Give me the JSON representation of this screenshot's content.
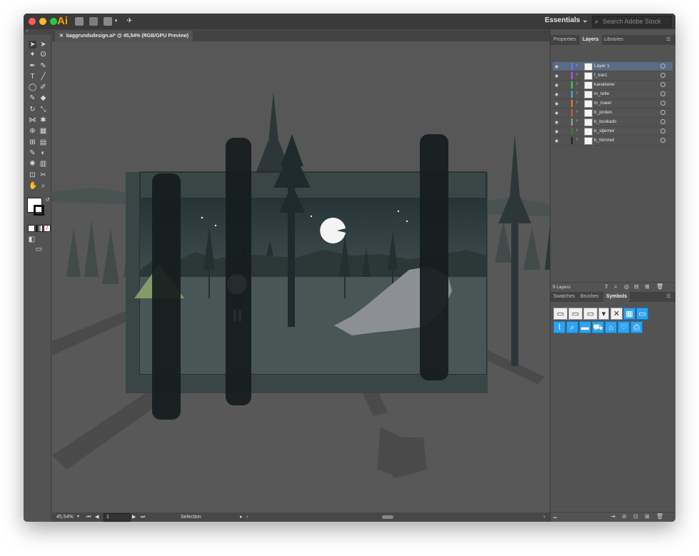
{
  "app": {
    "logo": "Ai",
    "workspace": "Essentials",
    "stock_placeholder": "Search Adobe Stock"
  },
  "document": {
    "tab_title": "baggrundsdesign.ai* @ 45,54% (RGB/GPU Preview)"
  },
  "status": {
    "zoom": "45,54%",
    "artboard": "1",
    "tool": "Selection"
  },
  "panels": {
    "top_tabs": [
      "Properties",
      "Layers",
      "Libraries"
    ],
    "layers_count": "9 Layers",
    "bottom_tabs": [
      "Swatches",
      "Brushes",
      "Symbols"
    ]
  },
  "layers": [
    {
      "name": "Layer 1",
      "color": "#4f7fff"
    },
    {
      "name": "f_træ1",
      "color": "#c44cff"
    },
    {
      "name": "karakterer",
      "color": "#3fd15a"
    },
    {
      "name": "m_telte",
      "color": "#3fb2e0"
    },
    {
      "name": "m_træer",
      "color": "#ff7a1a"
    },
    {
      "name": "b_jorden",
      "color": "#e35a2a"
    },
    {
      "name": "b_buskads",
      "color": "#a0a0a0"
    },
    {
      "name": "b_stjerner",
      "color": "#2c8a2c"
    },
    {
      "name": "b_himmel",
      "color": "#1f1f1f"
    }
  ]
}
